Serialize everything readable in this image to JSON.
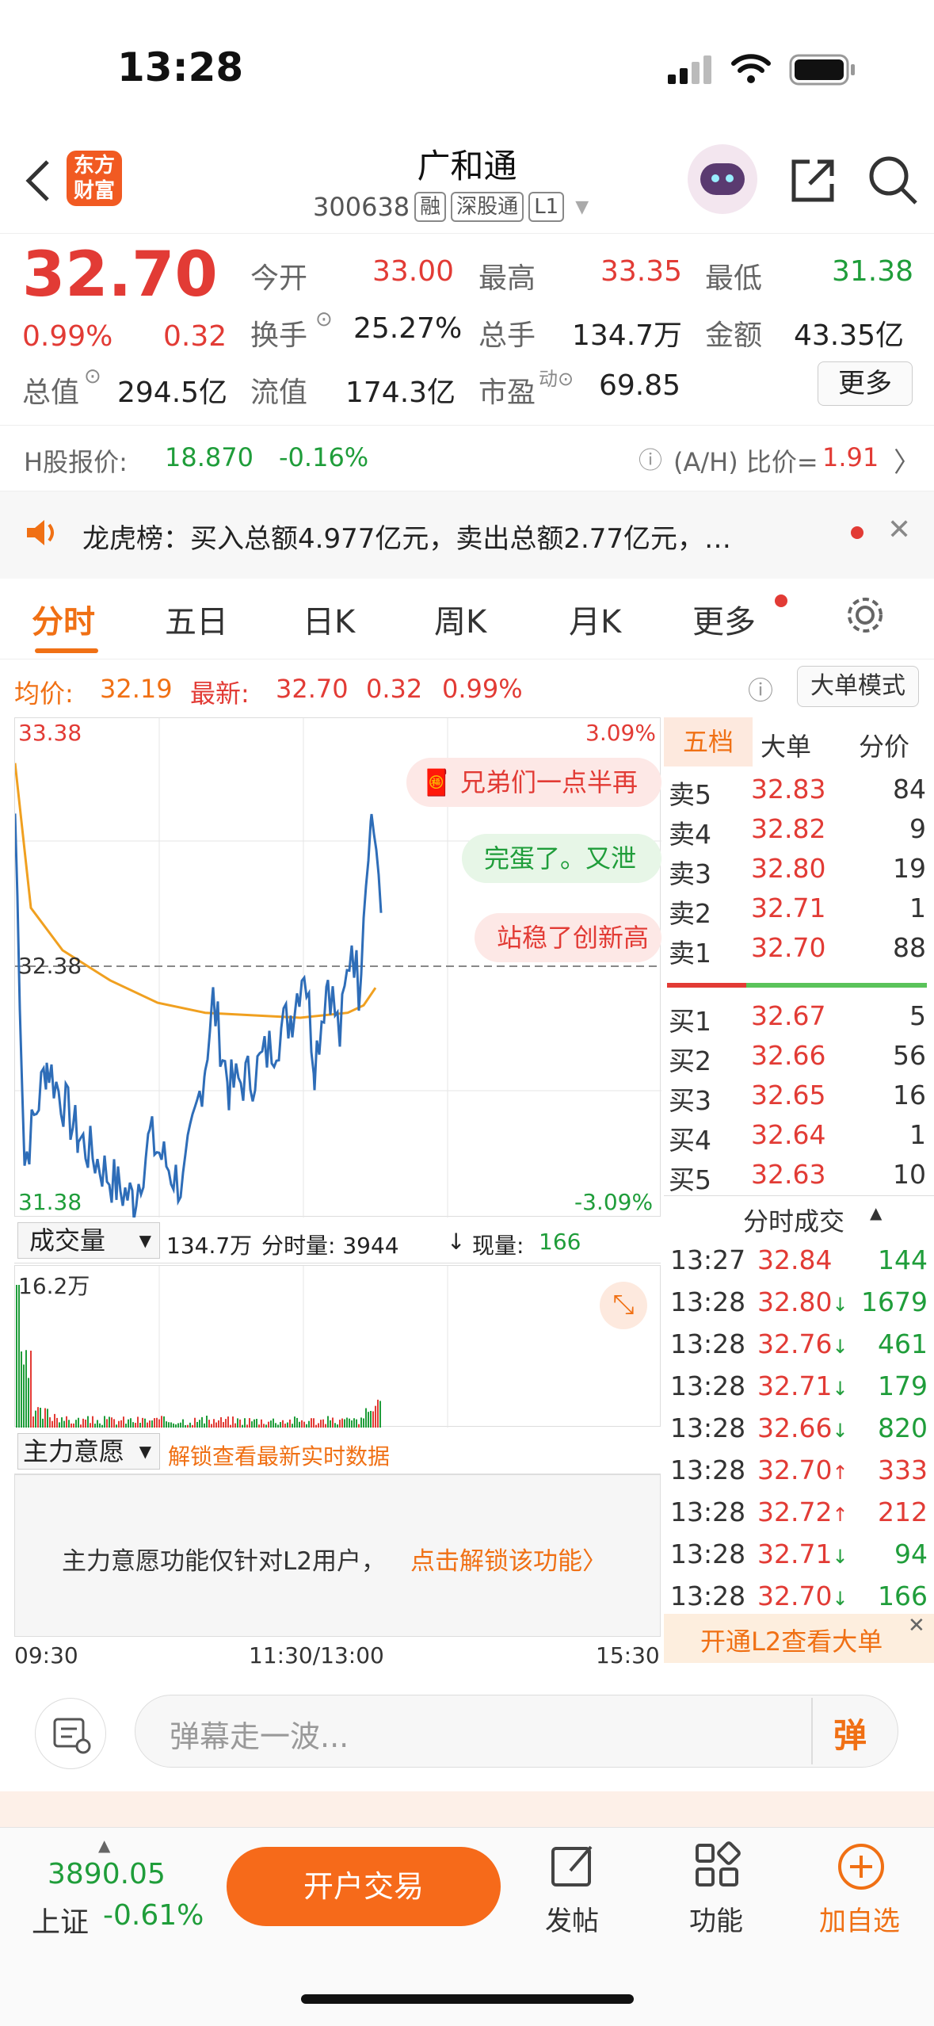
{
  "status": {
    "time": "13:28"
  },
  "header": {
    "logo": "东方\n财富",
    "title": "广和通",
    "code": "300638",
    "tags": [
      "融",
      "深股通",
      "L1"
    ]
  },
  "quote": {
    "price": "32.70",
    "change_pct": "0.99%",
    "change": "0.32",
    "fields": [
      {
        "label": "今开",
        "value": "33.00",
        "color": "red"
      },
      {
        "label": "最高",
        "value": "33.35",
        "color": "red"
      },
      {
        "label": "最低",
        "value": "31.38",
        "color": "green"
      },
      {
        "label": "换手",
        "value": "25.27%",
        "color": "dark"
      },
      {
        "label": "总手",
        "value": "134.7万",
        "color": "dark"
      },
      {
        "label": "金额",
        "value": "43.35亿",
        "color": "dark"
      },
      {
        "label": "总值",
        "value": "294.5亿",
        "color": "dark"
      },
      {
        "label": "流值",
        "value": "174.3亿",
        "color": "dark"
      },
      {
        "label": "市盈",
        "value": "69.85",
        "color": "dark"
      }
    ],
    "more_label": "更多"
  },
  "hshare": {
    "label": "H股报价:",
    "price": "18.870",
    "pct": "-0.16%",
    "ratio_label": "(A/H) 比价=",
    "ratio": "1.91"
  },
  "news": {
    "text": "龙虎榜：买入总额4.977亿元，卖出总额2.77亿元，…"
  },
  "tabs": [
    "分时",
    "五日",
    "日K",
    "周K",
    "月K",
    "更多"
  ],
  "avg": {
    "label_avg": "均价:",
    "avg": "32.19",
    "label_new": "最新:",
    "new": "32.70",
    "chg": "0.32",
    "pct": "0.99%",
    "mode_btn": "大单模式"
  },
  "chart": {
    "y_max": "33.38",
    "y_min": "31.38",
    "y_mid": "32.38",
    "pct_max": "3.09%",
    "pct_min": "-3.09%",
    "danmu": [
      "兄弟们一点半再",
      "完蛋了。又泄",
      "站稳了创新高"
    ],
    "x_labels": [
      "09:30",
      "11:30/13:00",
      "15:30"
    ],
    "vol_label": "成交量",
    "vol_total": "134.7万",
    "vol_split": "分时量: 3944",
    "vol_now_label": "现量:",
    "vol_now": "166",
    "vol_max": "16.2万",
    "ind_label": "主力意愿",
    "ind_unlock": "解锁查看最新实时数据",
    "ind_msg": "主力意愿功能仅针对L2用户，",
    "ind_link": "点击解锁该功能〉"
  },
  "chart_data": {
    "type": "line",
    "title": "",
    "x": [
      "09:30",
      "11:30/13:00",
      "15:30"
    ],
    "ylim": [
      31.38,
      33.38
    ],
    "series": [
      {
        "name": "均价",
        "values": [
          33.2,
          32.6,
          32.32,
          32.2,
          32.19,
          32.19,
          32.19,
          32.2,
          32.3
        ]
      },
      {
        "name": "最新",
        "values": [
          33.0,
          31.5,
          32.0,
          31.6,
          31.4,
          32.2,
          32.1,
          32.5,
          33.3,
          32.7
        ]
      }
    ]
  },
  "orderbook": {
    "tabs": [
      "五档",
      "大单",
      "分价"
    ],
    "asks": [
      [
        "卖5",
        "32.83",
        "84"
      ],
      [
        "卖4",
        "32.82",
        "9"
      ],
      [
        "卖3",
        "32.80",
        "19"
      ],
      [
        "卖2",
        "32.71",
        "1"
      ],
      [
        "卖1",
        "32.70",
        "88"
      ]
    ],
    "bids": [
      [
        "买1",
        "32.67",
        "5"
      ],
      [
        "买2",
        "32.66",
        "56"
      ],
      [
        "买3",
        "32.65",
        "16"
      ],
      [
        "买4",
        "32.64",
        "1"
      ],
      [
        "买5",
        "32.63",
        "10"
      ]
    ],
    "trades_title": "分时成交",
    "trades": [
      [
        "13:27",
        "32.84",
        "",
        "144",
        "green"
      ],
      [
        "13:28",
        "32.80",
        "↓",
        "1679",
        "green"
      ],
      [
        "13:28",
        "32.76",
        "↓",
        "461",
        "green"
      ],
      [
        "13:28",
        "32.71",
        "↓",
        "179",
        "green"
      ],
      [
        "13:28",
        "32.66",
        "↓",
        "820",
        "green"
      ],
      [
        "13:28",
        "32.70",
        "↑",
        "333",
        "red"
      ],
      [
        "13:28",
        "32.72",
        "↑",
        "212",
        "red"
      ],
      [
        "13:28",
        "32.71",
        "↓",
        "94",
        "green"
      ],
      [
        "13:28",
        "32.70",
        "↓",
        "166",
        "green"
      ]
    ],
    "l2": "开通L2查看大单"
  },
  "comment": {
    "placeholder": "弹幕走一波...",
    "btn": "弹"
  },
  "bottom": {
    "index_val": "3890.05",
    "index_name": "上证",
    "index_pct": "-0.61%",
    "trade_btn": "开户交易",
    "post": "发帖",
    "func": "功能",
    "fav": "加自选"
  },
  "colors": {
    "up": "#e23b35",
    "down": "#1f9d3a",
    "accent": "#f15a22"
  }
}
